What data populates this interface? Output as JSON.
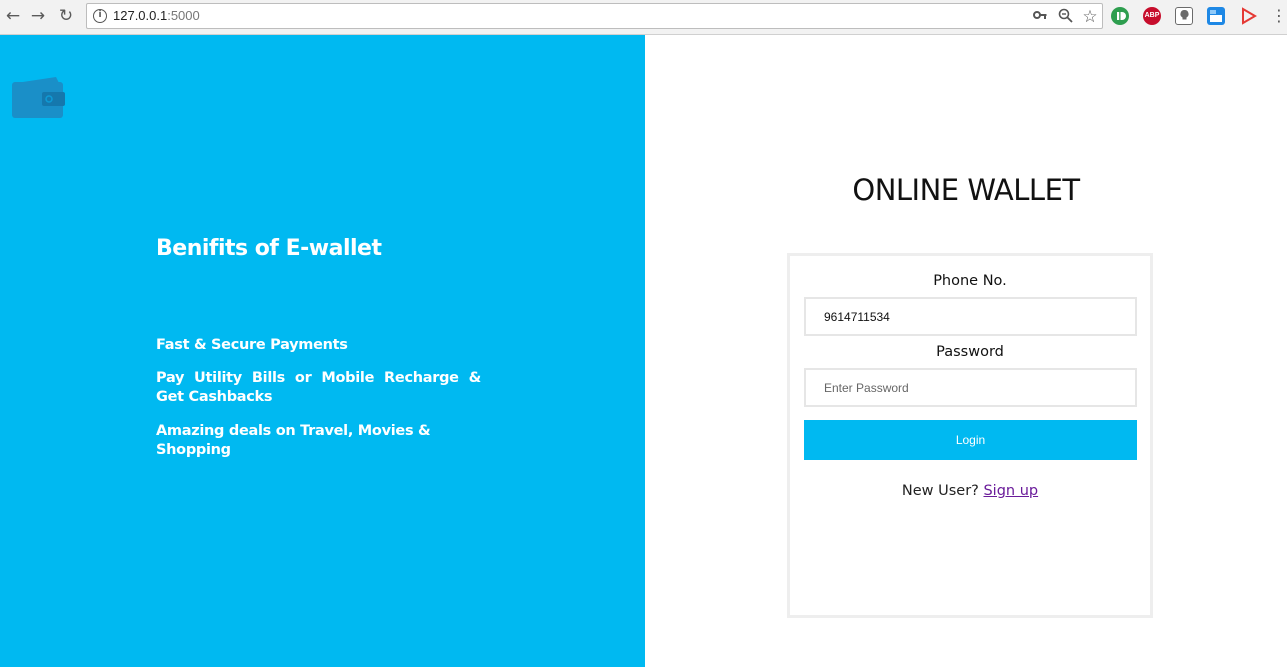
{
  "browser": {
    "url_host": "127.0.0.1",
    "url_port": ":5000",
    "extensions": [
      {
        "icon": "grammarly-icon",
        "color": "#15c39a",
        "text": ""
      },
      {
        "icon": "adblock-plus-icon",
        "color": "#c70d2c",
        "text": "ABP"
      },
      {
        "icon": "extension-icon-3",
        "color": "#6b6b6b",
        "text": ""
      },
      {
        "icon": "extension-icon-4",
        "color": "#1e88e5",
        "text": ""
      },
      {
        "icon": "play-icon",
        "color": "#e53935",
        "text": ""
      }
    ]
  },
  "hero": {
    "title": "Benifits of E-wallet",
    "benefits": [
      "Fast & Secure Payments",
      "Pay Utility Bills or Mobile Recharge & Get Cashbacks",
      "Amazing deals on Travel, Movies & Shopping"
    ]
  },
  "login": {
    "app_title": "ONLINE WALLET",
    "phone_label": "Phone No.",
    "phone_value": "9614711534",
    "password_label": "Password",
    "password_placeholder": "Enter Password",
    "login_button": "Login",
    "new_user_text": "New User?",
    "signup_link": "Sign up"
  },
  "colors": {
    "brand_blue": "#00b9f1",
    "link_purple": "#6a1b9a"
  }
}
